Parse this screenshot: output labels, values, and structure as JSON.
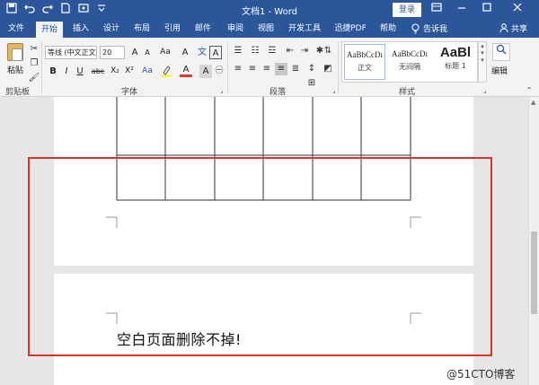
{
  "titlebar": {
    "document_title": "文档1 - Word",
    "login_label": "登录",
    "quick_access": [
      "save-icon",
      "undo-icon",
      "redo-icon",
      "new-doc-icon",
      "touch-mode-icon",
      "customize-icon"
    ],
    "window_controls": [
      "ribbon-display-icon",
      "minimize-icon",
      "maximize-icon",
      "close-icon"
    ]
  },
  "tabs": [
    {
      "label": "文件"
    },
    {
      "label": "开始",
      "active": true
    },
    {
      "label": "插入"
    },
    {
      "label": "设计"
    },
    {
      "label": "布局"
    },
    {
      "label": "引用"
    },
    {
      "label": "邮件"
    },
    {
      "label": "审阅"
    },
    {
      "label": "视图"
    },
    {
      "label": "开发工具"
    },
    {
      "label": "迅捷PDF"
    },
    {
      "label": "帮助"
    }
  ],
  "tell_me": "告诉我",
  "share": "共享",
  "ribbon": {
    "clipboard": {
      "paste_label": "粘贴",
      "group_label": "剪贴板"
    },
    "font": {
      "font_name": "等线 (中文正文)",
      "font_size": "20",
      "group_label": "字体",
      "buttons": [
        "B",
        "I",
        "U",
        "abc",
        "X₂",
        "X²",
        "Aa",
        "A",
        "A"
      ]
    },
    "paragraph": {
      "group_label": "段落"
    },
    "styles": {
      "group_label": "样式",
      "items": [
        {
          "sample": "AaBbCcDı",
          "name": "正文"
        },
        {
          "sample": "AaBbCcDı",
          "name": "无间隔"
        },
        {
          "sample": "AaBl",
          "name": "标题 1"
        }
      ]
    },
    "editing": {
      "label": "编辑"
    }
  },
  "document": {
    "text": "空白页面删除不掉!",
    "table": {
      "columns": 6,
      "rows": 2
    }
  },
  "watermark": "@51CTO博客",
  "colors": {
    "brand": "#2b579a",
    "highlight_border": "#d9342b"
  }
}
